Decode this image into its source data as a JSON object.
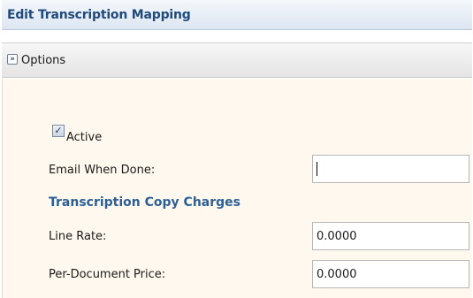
{
  "panel": {
    "title": "Edit Transcription Mapping"
  },
  "options": {
    "label": "Options",
    "icon": "chevron-double-down-icon"
  },
  "form": {
    "active": {
      "label": "Active",
      "checked": true
    },
    "email_when_done": {
      "label": "Email When Done:",
      "value": ""
    },
    "section_heading": "Transcription Copy Charges",
    "line_rate": {
      "label": "Line Rate:",
      "value": "0.0000"
    },
    "per_document_price": {
      "label": "Per-Document Price:",
      "value": "0.0000"
    }
  },
  "colors": {
    "title": "#1f4a7d",
    "section_heading": "#2d5f96",
    "content_background": "#fff8ee"
  }
}
